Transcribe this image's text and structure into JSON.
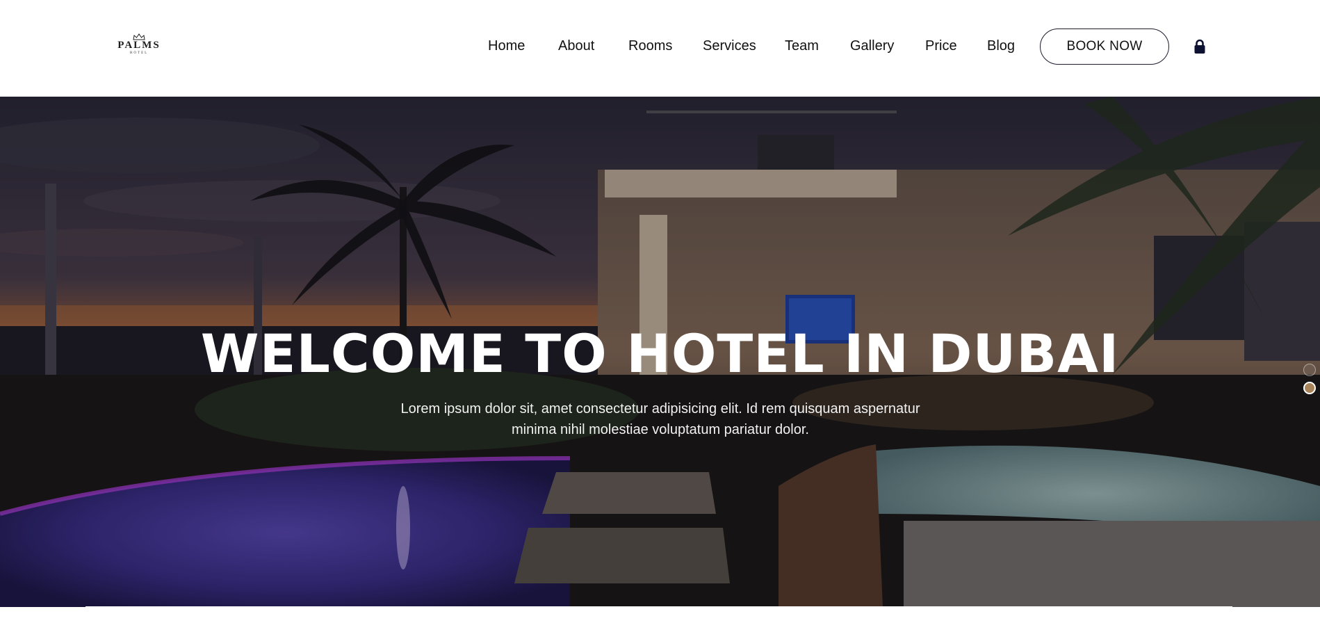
{
  "brand": {
    "logo_text": "PALMS",
    "logo_subtext": "HOTEL"
  },
  "nav": {
    "items": [
      {
        "label": "Home"
      },
      {
        "label": "About"
      },
      {
        "label": "Rooms"
      },
      {
        "label": "Services"
      },
      {
        "label": "Team"
      },
      {
        "label": "Gallery"
      },
      {
        "label": "Price"
      },
      {
        "label": "Blog"
      }
    ],
    "book_now_label": "BOOK NOW",
    "lock_icon": "lock-icon"
  },
  "hero": {
    "title": "WELCOME TO HOTEL IN DUBAI",
    "text_line1": "Lorem ipsum dolor sit, amet consectetur adipisicing elit. Id rem quisquam aspernatur",
    "text_line2": "minima nihil molestiae voluptatum pariatur dolor.",
    "slider": {
      "count": 2,
      "active_index": 1
    },
    "colors": {
      "active_dot": "#a8835a",
      "overlay": "#0a0814"
    }
  },
  "colors": {
    "header_bg": "#ffffff",
    "button_border": "#1b1b2f",
    "text_dark": "#111111"
  }
}
